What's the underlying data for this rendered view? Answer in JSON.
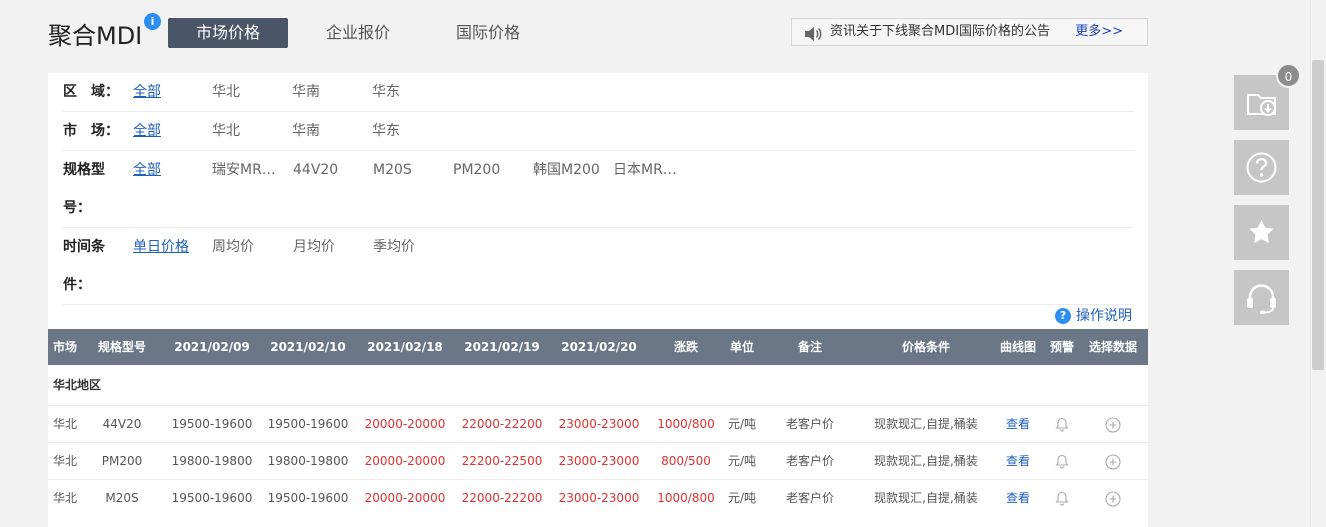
{
  "header": {
    "title": "聚合MDI",
    "info": "i",
    "tabs": [
      "市场价格",
      "企业报价",
      "国际价格"
    ],
    "notice": "资讯关于下线聚合MDI国际价格的公告",
    "more": "更多>>"
  },
  "filters": {
    "region": {
      "label": "区　域：",
      "options": [
        "全部",
        "华北",
        "华南",
        "华东"
      ]
    },
    "market": {
      "label": "市　场：",
      "options": [
        "全部",
        "华北",
        "华南",
        "华东"
      ]
    },
    "spec": {
      "label_line1": "规格型",
      "label_line2": "号：",
      "options": [
        "全部",
        "瑞安MR…",
        "44V20",
        "M20S",
        "PM200",
        "韩国M200",
        "日本MR…"
      ]
    },
    "time": {
      "label_line1": "时间条",
      "label_line2": "件：",
      "options": [
        "单日价格",
        "周均价",
        "月均价",
        "季均价"
      ]
    },
    "help": "操作说明"
  },
  "table": {
    "headers": [
      "市场",
      "规格型号",
      "2021/02/09",
      "2021/02/10",
      "2021/02/18",
      "2021/02/19",
      "2021/02/20",
      "涨跌",
      "单位",
      "备注",
      "价格条件",
      "曲线图",
      "预警",
      "选择数据"
    ],
    "region": "华北地区",
    "rows": [
      [
        "华北",
        "44V20",
        "19500-19600",
        "19500-19600",
        "20000-20000",
        "22000-22200",
        "23000-23000",
        "1000/800",
        "元/吨",
        "老客户价",
        "现款现汇,自提,桶装",
        "查看"
      ],
      [
        "华北",
        "PM200",
        "19800-19800",
        "19800-19800",
        "20000-20000",
        "22200-22500",
        "23000-23000",
        "800/500",
        "元/吨",
        "老客户价",
        "现款现汇,自提,桶装",
        "查看"
      ],
      [
        "华北",
        "M20S",
        "19500-19600",
        "19500-19600",
        "20000-20000",
        "22000-22200",
        "23000-23000",
        "1000/800",
        "元/吨",
        "老客户价",
        "现款现汇,自提,桶装",
        "查看"
      ]
    ]
  },
  "toolbar": {
    "badge": "0"
  },
  "colors": {
    "accent": "#1f5fbd",
    "up": "#e03131",
    "header_bg": "#6b7687",
    "tab_active": "#4a5568"
  }
}
